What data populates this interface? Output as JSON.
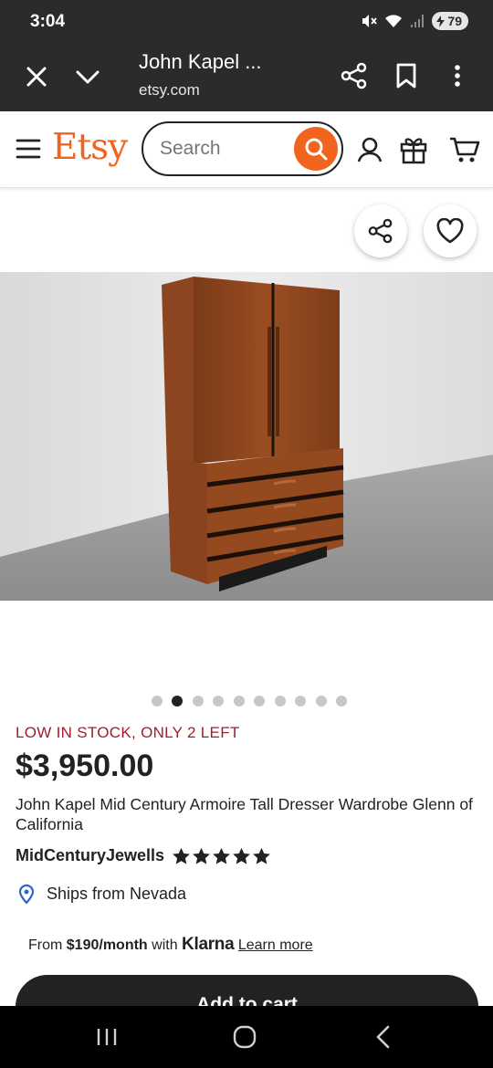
{
  "status_bar": {
    "time": "3:04",
    "battery": "79"
  },
  "tab_bar": {
    "title": "John Kapel ...",
    "url": "etsy.com"
  },
  "header": {
    "logo": "Etsy",
    "search_placeholder": "Search"
  },
  "product": {
    "image_count": 10,
    "active_image_index": 1,
    "stock_notice": "LOW IN STOCK, ONLY 2 LEFT",
    "price": "$3,950.00",
    "title": "John Kapel Mid Century Armoire Tall Dresser Wardrobe Glenn of California",
    "shop_name": "MidCenturyJewells",
    "rating_stars": 5,
    "ships_from": "Ships from Nevada"
  },
  "klarna": {
    "prefix": "From ",
    "amount": "$190/month",
    "middle": " with ",
    "brand": "Klarna",
    "learn_more": "Learn more"
  },
  "cta": {
    "add_to_cart": "Add to cart"
  },
  "colors": {
    "brand": "#f1641e",
    "stock": "#a61a2e",
    "dark": "#222222"
  },
  "icons": [
    "close-icon",
    "chevron-down-icon",
    "share-icon",
    "bookmark-icon",
    "more-vert-icon",
    "menu-icon",
    "search-icon",
    "user-icon",
    "gift-icon",
    "cart-icon",
    "heart-icon",
    "location-pin-icon",
    "star-icon"
  ]
}
